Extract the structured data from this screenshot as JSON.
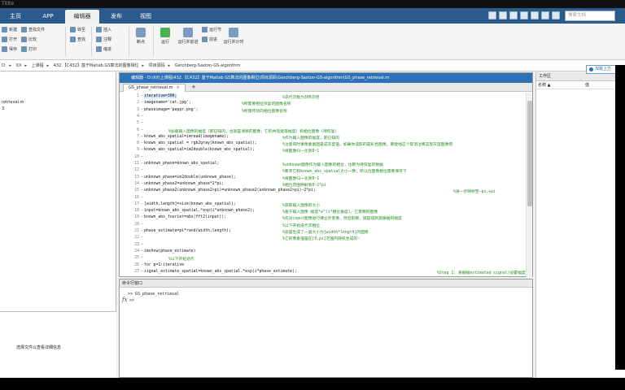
{
  "window": {
    "title": "Titlte"
  },
  "tabs": [
    {
      "label": "主页"
    },
    {
      "label": "APP"
    },
    {
      "label": "编辑器"
    },
    {
      "label": "发布"
    },
    {
      "label": "视图"
    }
  ],
  "search": {
    "placeholder": "搜索文档"
  },
  "ribbon": {
    "file_group": [
      "新建",
      "打开",
      "保存"
    ],
    "nav_group": [
      "查找文件",
      "比较",
      "打印"
    ],
    "edit_group": [
      "转至",
      "查找"
    ],
    "text_group": [
      "插入",
      "注释",
      "缩进"
    ],
    "breakpoint": "断点",
    "run_group": [
      "运行",
      "运行并前进",
      "运行节",
      "前进",
      "运行并计时"
    ]
  },
  "address": {
    "parts": [
      "D:",
      "XX",
      "上课程",
      "432.【C432】基于Matlab GS算法的图像相位",
      "项目源码",
      "Gerchberg-Saxton-GS-algorithm"
    ]
  },
  "left_panel": {
    "file_item": "retrieval.m",
    "file_item2": "3",
    "detail_text": "选择文件以查看详细信息"
  },
  "editor": {
    "title": "编辑器 - D:\\XX\\上课程\\432.【C432】基于Matlab GS算法的图像相位\\项目源码\\Gerchberg-Saxton-GS-algorithm\\GS_phase_retrieval.m",
    "tab_label": "GS_phase_retrieval.m",
    "tab_close": "×",
    "add_tab": "+",
    "code_lines": [
      {
        "n": "1",
        "code": "iterative=300;",
        "comment": "%迭代次数为300次吧"
      },
      {
        "n": "2",
        "code": "imagename='cat.jpg';",
        "comment": "%所需要相位恢复的图像名称"
      },
      {
        "n": "3",
        "code": "phaseimage='peppr.png';",
        "comment": "%所需传动的相位图像名称"
      },
      {
        "n": "4",
        "code": "",
        "comment": ""
      },
      {
        "n": "5",
        "code": "",
        "comment": ""
      },
      {
        "n": "6",
        "code": "",
        "comment": "%加载输入图像的幅度（即已知的，也就是清晰的图像，它的共现能等幅度）和相位图像（待恢复）"
      },
      {
        "n": "7",
        "code": "known_abs_spatial=imread(imagename);",
        "comment": "%作为输入图像的幅度，即已知的"
      },
      {
        "n": "8",
        "code": "known_abs_spatial = rgb2gray(known_abs_spatial);",
        "comment": "%注意有时事像素素图是成灰度值，如果你读取的是彩色图像，要能地这个取消注释实现灰度图像吧"
      },
      {
        "n": "9",
        "code": "known_abs_spatial=im2double(known_abs_spatial);",
        "comment": "%将图像归一化到0~1"
      },
      {
        "n": "10",
        "code": "",
        "comment": ""
      },
      {
        "n": "11",
        "code": "unknown_phase=known_abs_spatial;",
        "comment": "%unknown图像作为输入图像的相位，也即为待恢复的数据"
      },
      {
        "n": "12",
        "code": "",
        "comment": "%要求它和known_abs_spatial大小一致，所以位图像相位需要保存下"
      },
      {
        "n": "13",
        "code": "unknown_phase=im2double(unknown_phase);",
        "comment": "%将图像归一化到0~1"
      },
      {
        "n": "14",
        "code": "unknown_phase2=unknown_phase*2*pi;",
        "comment": "%相位范围映射到0~2*pi"
      },
      {
        "n": "15",
        "code": "unknown_phase2(unknown_phase2>pi)=unknown_phase2(unknown_phase2>pi)-2*pi;",
        "comment": "%进一步映射至-pi,+pi"
      },
      {
        "n": "16",
        "code": "",
        "comment": ""
      },
      {
        "n": "17",
        "code": "[width,length]=size(known_abs_spatial);",
        "comment": "%获取输入图像的大小"
      },
      {
        "n": "18",
        "code": "input=known_abs_spatial.*exp(i*unknown_phase2);",
        "comment": "%基于输入图像 幅度*e^(i*相位角度)，它需要的图像"
      },
      {
        "n": "19",
        "code": "known_abs_fourier=abs(fft2(input));",
        "comment": "%先对input图像进行傅立叶变换，然后取模，就是得到其振幅的幅度"
      },
      {
        "n": "20",
        "code": "",
        "comment": "%以下开始迭代求相位"
      },
      {
        "n": "21",
        "code": "phase_estimate=pi*rand(width,length);",
        "comment": "%迭是生成了一副大小为[width*length]的图像"
      },
      {
        "n": "22",
        "code": "",
        "comment": "%它的像素值是在[0,pi]范围内随机生成的~"
      },
      {
        "n": "23",
        "code": "",
        "comment": ""
      },
      {
        "n": "24",
        "code": "imshow(phase_estimate)",
        "comment": ""
      },
      {
        "n": "25",
        "code": "",
        "comment": "%以下开始迭代"
      },
      {
        "n": "26",
        "code": "for p=1:iterative",
        "comment": ""
      },
      {
        "n": "27",
        "code": "    signal_estimate_spatial=known_abs_spatial.*exp(i*phase_estimate);",
        "comment": "%Step 1: 将振幅estimated signal)设置幅度*e^(i*相位角度)设置振数形式"
      }
    ]
  },
  "command_window": {
    "title": "命令行窗口",
    "line1": ">> GS_phase_retrieval",
    "fx": "fx",
    "prompt": ">>"
  },
  "workspace": {
    "title": "工作区",
    "col_name": "名称 ▲",
    "col_value": "值",
    "trial_button": "加载上方"
  }
}
